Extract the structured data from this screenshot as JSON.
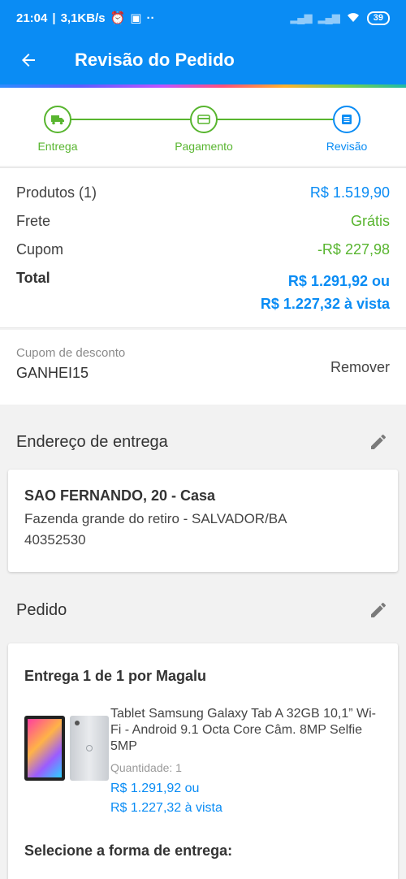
{
  "status_bar": {
    "time": "21:04",
    "speed": "3,1KB/s",
    "dots": "··",
    "battery": "39"
  },
  "app_bar": {
    "back_icon": "arrow-left-icon",
    "title": "Revisão do Pedido"
  },
  "stepper": {
    "steps": [
      {
        "label": "Entrega",
        "icon": "truck-icon",
        "state": "done"
      },
      {
        "label": "Pagamento",
        "icon": "card-icon",
        "state": "done"
      },
      {
        "label": "Revisão",
        "icon": "list-icon",
        "state": "active"
      }
    ]
  },
  "summary": {
    "products_label": "Produtos (1)",
    "products_value": "R$ 1.519,90",
    "shipping_label": "Frete",
    "shipping_value": "Grátis",
    "coupon_label": "Cupom",
    "coupon_value": "-R$ 227,98",
    "total_label": "Total",
    "total_value_1": "R$ 1.291,92 ou",
    "total_value_2": "R$ 1.227,32 à vista"
  },
  "coupon": {
    "label": "Cupom de desconto",
    "code": "GANHEI15",
    "remove_label": "Remover"
  },
  "address_section": {
    "title": "Endereço de entrega",
    "line1": "SAO FERNANDO, 20 - Casa",
    "line2": "Fazenda grande do retiro - SALVADOR/BA",
    "line3": "40352530"
  },
  "order_section": {
    "title": "Pedido",
    "delivery": "Entrega 1 de 1 por Magalu",
    "product": {
      "name": "Tablet Samsung Galaxy Tab A 32GB 10,1” Wi-Fi - Android 9.1 Octa Core Câm. 8MP Selfie 5MP",
      "quantity": "Quantidade:  1",
      "price_1": "R$ 1.291,92 ou",
      "price_2": "R$ 1.227,32 à vista"
    },
    "select_delivery": "Selecione a forma de entrega:"
  },
  "colors": {
    "primary": "#0a8cf4",
    "success": "#58b52f"
  }
}
